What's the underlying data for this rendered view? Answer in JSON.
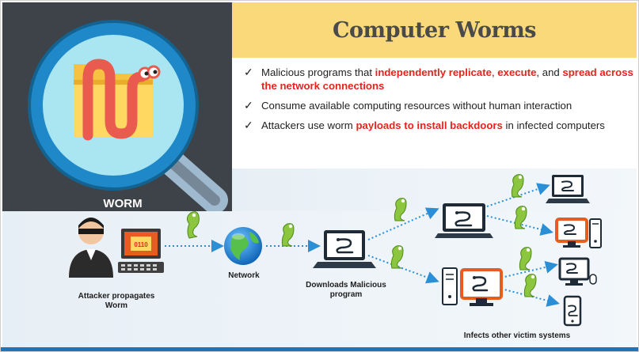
{
  "title": "Computer Worms",
  "worm_badge": "WORM",
  "bullets": [
    {
      "parts": [
        {
          "t": "Malicious programs that ",
          "hl": false
        },
        {
          "t": "independently replicate",
          "hl": true
        },
        {
          "t": ", ",
          "hl": false
        },
        {
          "t": "execute",
          "hl": true
        },
        {
          "t": ", and ",
          "hl": false
        },
        {
          "t": "spread across the network connections",
          "hl": true
        }
      ]
    },
    {
      "parts": [
        {
          "t": "Consume available computing resources without human interaction",
          "hl": false
        }
      ]
    },
    {
      "parts": [
        {
          "t": "Attackers use worm ",
          "hl": false
        },
        {
          "t": "payloads to install backdoors",
          "hl": true
        },
        {
          "t": " in infected computers",
          "hl": false
        }
      ]
    }
  ],
  "diagram": {
    "attacker_label": "Attacker propagates Worm",
    "network_label": "Network",
    "downloads_label": "Downloads Malicious program",
    "infects_label": "Infects other victim systems"
  },
  "colors": {
    "title_band": "#fad97a",
    "highlight": "#e8231b",
    "left_panel": "#3d4349",
    "worm": "#e95b4f",
    "bottom_bar": "#1f73b8",
    "infected": "#e85d1f"
  },
  "icons": [
    "check-icon",
    "magnifier-icon",
    "folder-icon",
    "worm-icon",
    "attacker-icon",
    "globe-icon",
    "laptop-icon",
    "desktop-icon",
    "phone-icon"
  ]
}
